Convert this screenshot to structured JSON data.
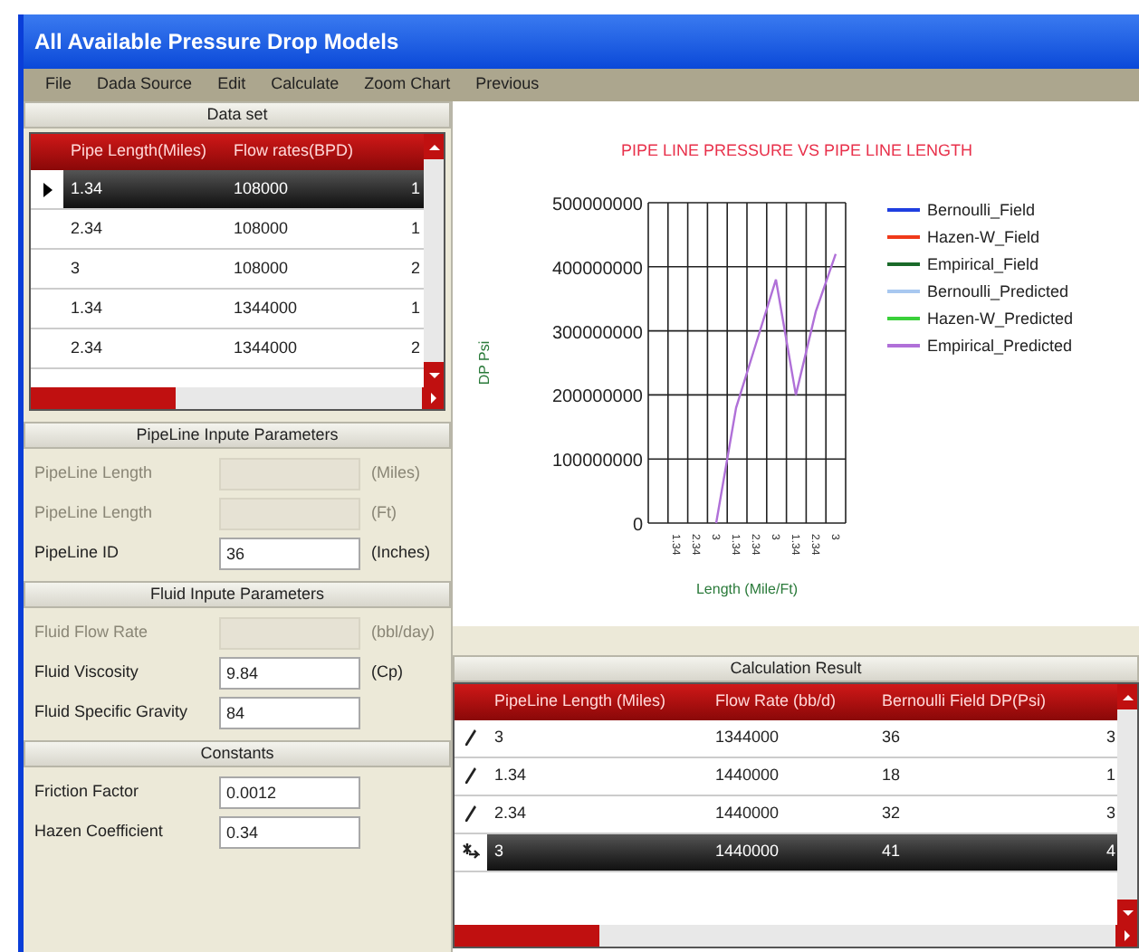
{
  "window": {
    "title": "All Available Pressure Drop Models"
  },
  "menu": [
    "File",
    "Dada Source",
    "Edit",
    "Calculate",
    "Zoom Chart",
    "Previous"
  ],
  "data_set": {
    "title": "Data set",
    "columns": [
      "Pipe Length(Miles)",
      "Flow rates(BPD)"
    ],
    "rows": [
      {
        "cells": [
          "1.34",
          "108000",
          "1"
        ],
        "selected": true
      },
      {
        "cells": [
          "2.34",
          "108000",
          "1"
        ],
        "selected": false
      },
      {
        "cells": [
          "3",
          "108000",
          "2"
        ],
        "selected": false
      },
      {
        "cells": [
          "1.34",
          "1344000",
          "1"
        ],
        "selected": false
      },
      {
        "cells": [
          "2.34",
          "1344000",
          "2"
        ],
        "selected": false
      }
    ]
  },
  "sections": [
    {
      "title": "PipeLine Inpute Parameters",
      "fields": [
        {
          "label": "PipeLine Length",
          "unit": "(Miles)",
          "disabled": true
        },
        {
          "label": "PipeLine Length",
          "unit": "(Ft)",
          "disabled": true
        },
        {
          "label": "PipeLine ID",
          "value": "36",
          "unit": "(Inches)",
          "disabled": false
        }
      ]
    },
    {
      "title": "Fluid Inpute Parameters",
      "fields": [
        {
          "label": "Fluid Flow Rate",
          "unit": "(bbl/day)",
          "disabled": true
        },
        {
          "label": "Fluid Viscosity",
          "value": "9.84",
          "unit": "(Cp)",
          "disabled": false
        },
        {
          "label": "Fluid Specific Gravity",
          "value": "84",
          "disabled": false
        }
      ]
    },
    {
      "title": "Constants",
      "fields": [
        {
          "label": "Friction Factor",
          "value": "0.0012",
          "disabled": false
        },
        {
          "label": "Hazen Coefficient",
          "value": "0.34",
          "disabled": false
        }
      ]
    }
  ],
  "chart": {
    "chart_data": {
      "type": "line",
      "title": "PIPE LINE PRESSURE VS PIPE LINE LENGTH",
      "xlabel": "Length (Mile/Ft)",
      "ylabel": "DP Psi",
      "categories": [
        "1.34",
        "2.34",
        "3",
        "1.34",
        "2.34",
        "3",
        "1.34",
        "2.34",
        "3"
      ],
      "yticks": [
        0,
        100000000,
        200000000,
        300000000,
        400000000,
        500000000
      ],
      "ylim": [
        0,
        500000000
      ],
      "grid": true,
      "series": [
        {
          "name": "Bernoulli_Field",
          "color": "#1f3fe0",
          "values": [
            null,
            null,
            null,
            null,
            null,
            null,
            null,
            null,
            null
          ]
        },
        {
          "name": "Hazen-W_Field",
          "color": "#f03a1a",
          "values": [
            null,
            null,
            null,
            null,
            null,
            null,
            null,
            null,
            null
          ]
        },
        {
          "name": "Empirical_Field",
          "color": "#1a6a2a",
          "values": [
            null,
            null,
            null,
            null,
            null,
            null,
            null,
            null,
            null
          ]
        },
        {
          "name": "Bernoulli_Predicted",
          "color": "#a8c8f0",
          "values": [
            null,
            null,
            null,
            null,
            null,
            null,
            null,
            null,
            null
          ]
        },
        {
          "name": "Hazen-W_Predicted",
          "color": "#3ad03a",
          "values": [
            null,
            null,
            null,
            null,
            null,
            null,
            null,
            null,
            null
          ]
        },
        {
          "name": "Empirical_Predicted",
          "color": "#b070d8",
          "values": [
            null,
            null,
            0,
            180000000,
            280000000,
            380000000,
            200000000,
            330000000,
            420000000
          ]
        }
      ]
    }
  },
  "result": {
    "title": "Calculation Result",
    "columns": [
      "PipeLine Length (Miles)",
      "Flow Rate (bb/d)",
      "Bernoulli Field DP(Psi)"
    ],
    "rows": [
      {
        "cells": [
          "3",
          "1344000",
          "36",
          "3"
        ],
        "selected": false,
        "kind": "edit"
      },
      {
        "cells": [
          "1.34",
          "1440000",
          "18",
          "1"
        ],
        "selected": false,
        "kind": "edit"
      },
      {
        "cells": [
          "2.34",
          "1440000",
          "32",
          "3"
        ],
        "selected": false,
        "kind": "edit"
      },
      {
        "cells": [
          "3",
          "1440000",
          "41",
          "4"
        ],
        "selected": true,
        "kind": "new"
      }
    ]
  }
}
